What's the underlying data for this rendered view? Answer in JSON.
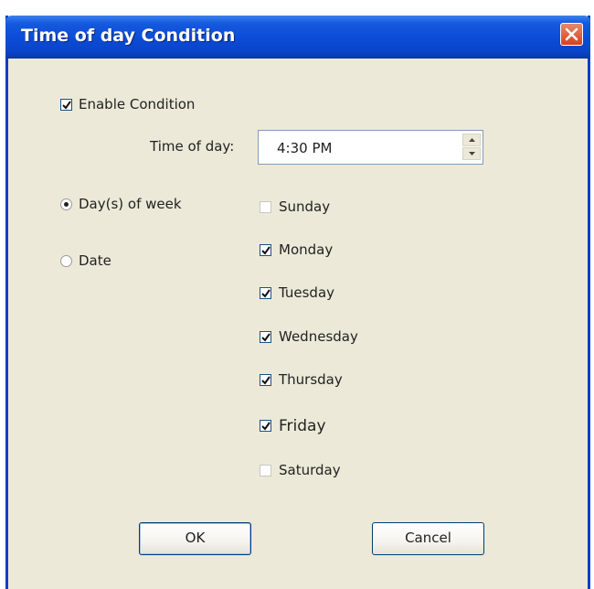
{
  "window": {
    "title": "Time of day Condition"
  },
  "enable_condition": {
    "label": "Enable Condition",
    "checked": true
  },
  "time_of_day": {
    "label": "Time of day:",
    "value": "4:30 PM"
  },
  "mode": {
    "options": [
      {
        "label": "Day(s) of week",
        "selected": true
      },
      {
        "label": "Date",
        "selected": false
      }
    ]
  },
  "days": [
    {
      "label": "Sunday",
      "checked": false
    },
    {
      "label": "Monday",
      "checked": true
    },
    {
      "label": "Tuesday",
      "checked": true
    },
    {
      "label": "Wednesday",
      "checked": true
    },
    {
      "label": "Thursday",
      "checked": true
    },
    {
      "label": "Friday",
      "checked": true
    },
    {
      "label": "Saturday",
      "checked": false
    }
  ],
  "buttons": {
    "ok": "OK",
    "cancel": "Cancel"
  },
  "icons": {
    "close": "close-icon",
    "spin_up": "arrow-up-icon",
    "spin_down": "arrow-down-icon",
    "check": "checkmark-icon"
  },
  "colors": {
    "titlebar": "#0b4bd6",
    "dialog_bg": "#ece9d8",
    "close_button": "#d2431c"
  }
}
